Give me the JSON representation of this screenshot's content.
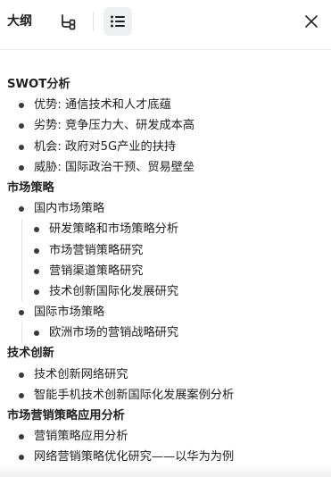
{
  "panel": {
    "title": "大纲",
    "colors": {
      "active_bg": "#eeeff1",
      "text": "#1f1f1f",
      "divider": "#ececec"
    },
    "icons": {
      "mindmap": "mindmap-icon",
      "list": "list-icon",
      "close": "close-icon"
    }
  },
  "outline": {
    "sections": [
      {
        "title": "SWOT分析",
        "items": [
          {
            "label": "优势: 通信技术和人才底蕴"
          },
          {
            "label": "劣势: 竞争压力大、研发成本高"
          },
          {
            "label": "机会: 政府对5G产业的扶持"
          },
          {
            "label": "威胁: 国际政治干预、贸易壁垒"
          }
        ]
      },
      {
        "title": "市场策略",
        "items": [
          {
            "label": "国内市场策略",
            "children": [
              {
                "label": "研发策略和市场策略分析"
              },
              {
                "label": "市场营销策略研究"
              },
              {
                "label": "营销渠道策略研究"
              },
              {
                "label": "技术创新国际化发展研究"
              }
            ]
          },
          {
            "label": "国际市场策略",
            "children": [
              {
                "label": "欧洲市场的营销战略研究"
              }
            ]
          }
        ]
      },
      {
        "title": "技术创新",
        "items": [
          {
            "label": "技术创新网络研究"
          },
          {
            "label": "智能手机技术创新国际化发展案例分析"
          }
        ]
      },
      {
        "title": "市场营销策略应用分析",
        "items": [
          {
            "label": "营销策略应用分析"
          },
          {
            "label": "网络营销策略优化研究——以华为为例"
          }
        ]
      }
    ]
  }
}
